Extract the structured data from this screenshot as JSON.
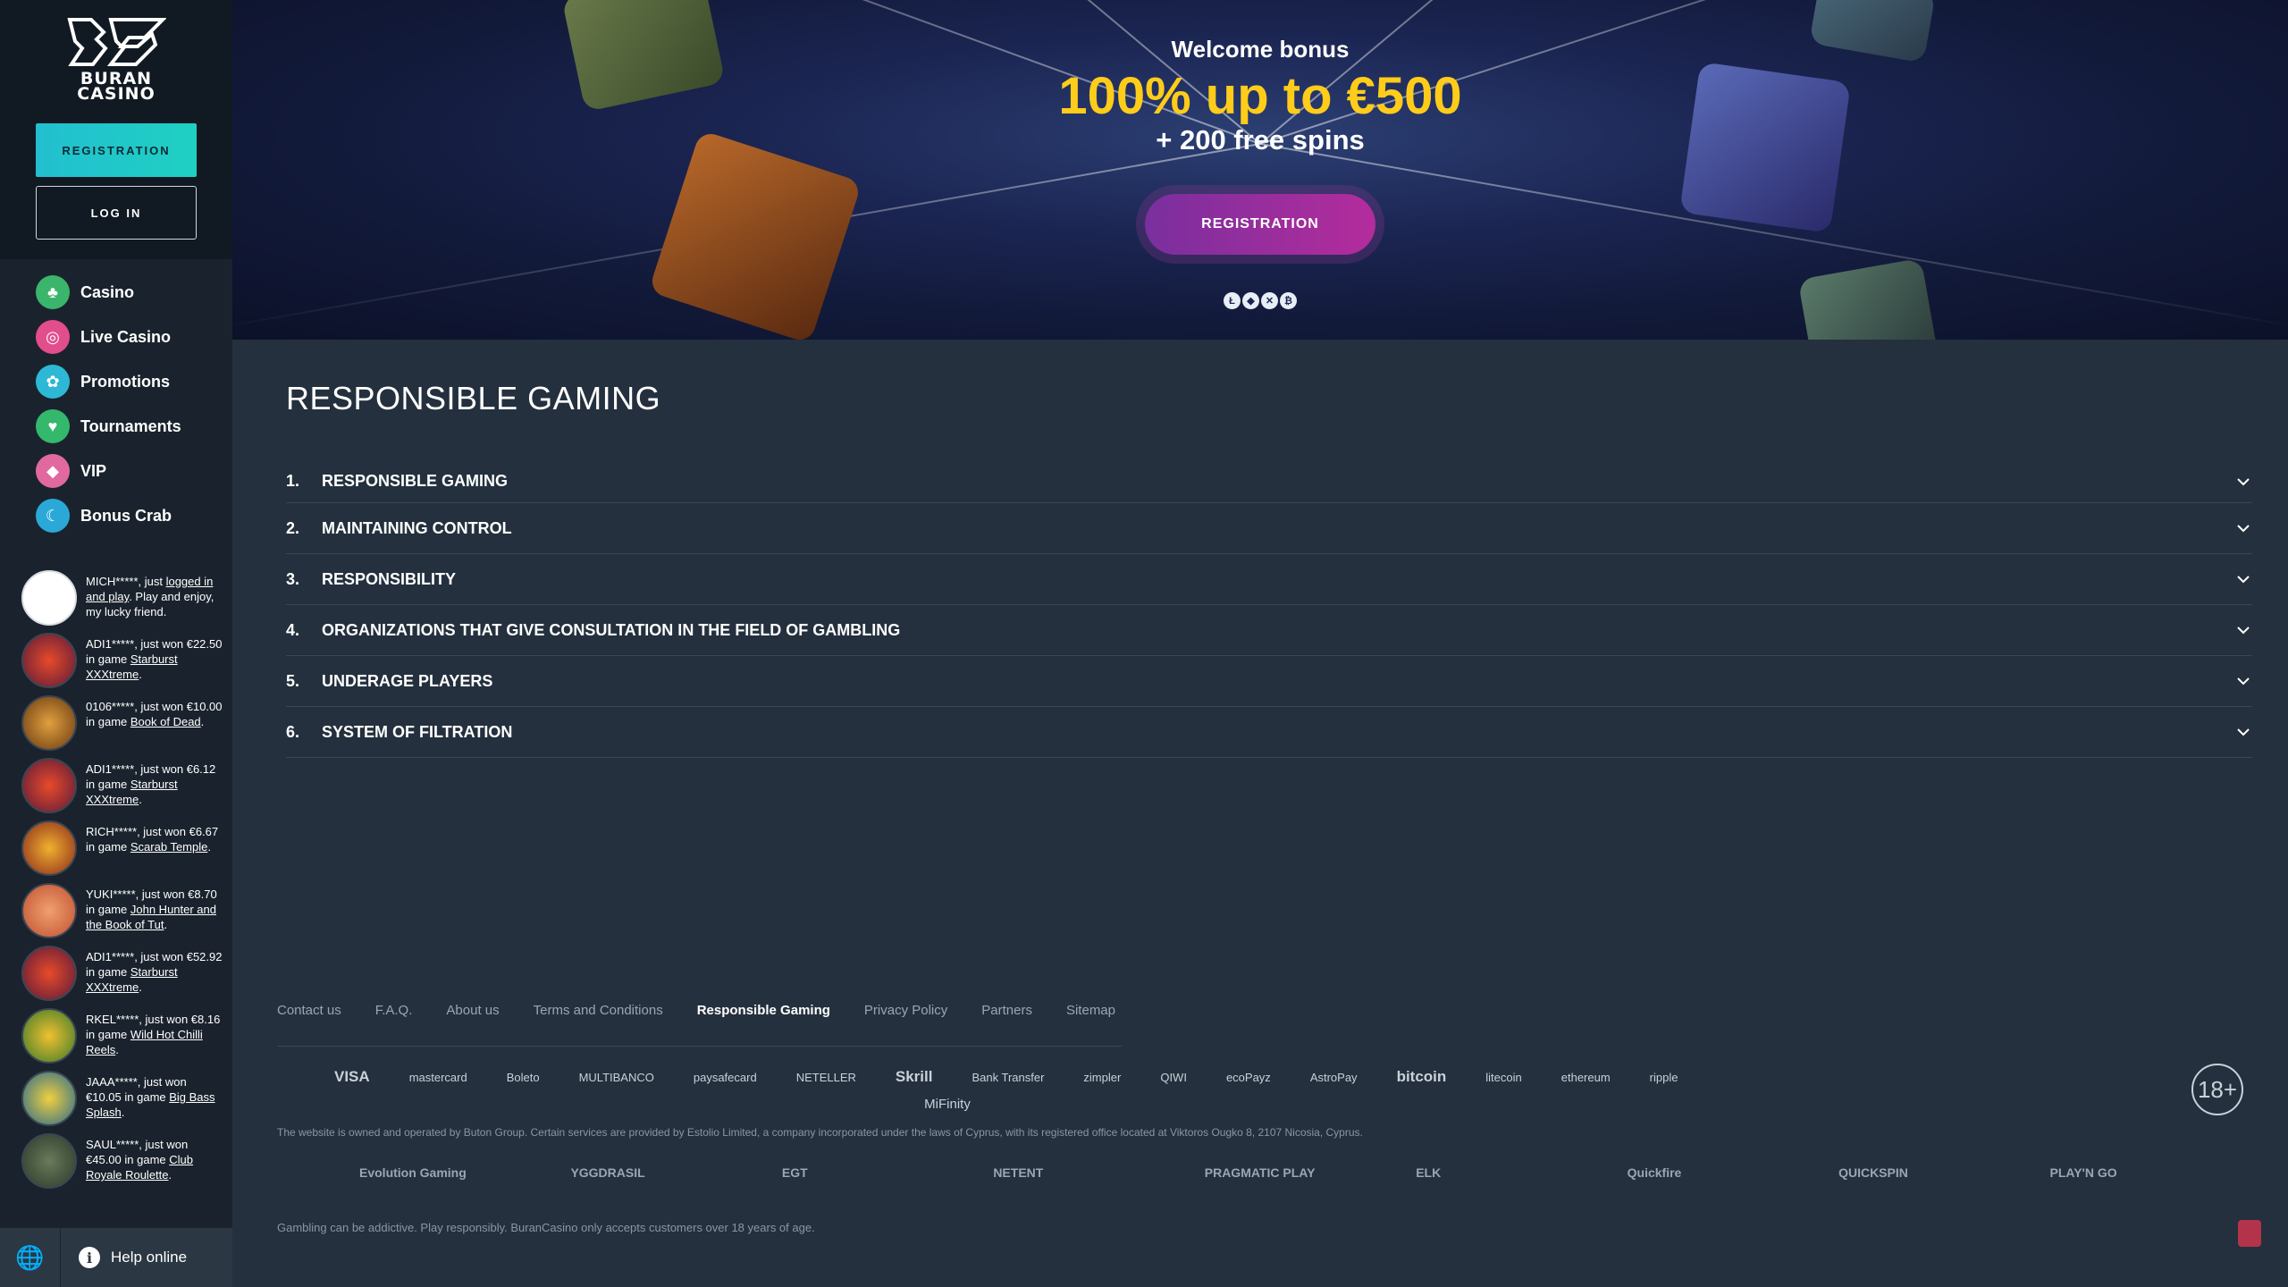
{
  "brand": {
    "logo_line1": "BURAN",
    "logo_line2": "CASINO"
  },
  "auth": {
    "register_label": "REGISTRATION",
    "login_label": "LOG IN"
  },
  "nav": [
    {
      "label": "Casino",
      "color": "#3bb56b",
      "icon": "casino-icon"
    },
    {
      "label": "Live Casino",
      "color": "#e24d8c",
      "icon": "live-casino-icon"
    },
    {
      "label": "Promotions",
      "color": "#2db9d6",
      "icon": "gift-icon"
    },
    {
      "label": "Tournaments",
      "color": "#33b86c",
      "icon": "trophy-icon"
    },
    {
      "label": "VIP",
      "color": "#e06aa0",
      "icon": "diamond-icon"
    },
    {
      "label": "Bonus Crab",
      "color": "#2aa9d8",
      "icon": "crab-icon"
    }
  ],
  "feed": [
    {
      "pre": "MICH*****, just ",
      "link": "logged in and play",
      "post": ". Play and enjoy, my lucky friend."
    },
    {
      "pre": "ADI1*****, just won €22.50 in game ",
      "link": "Starburst XXXtreme",
      "post": "."
    },
    {
      "pre": "0106*****, just won €10.00 in game ",
      "link": "Book of Dead",
      "post": "."
    },
    {
      "pre": "ADI1*****, just won €6.12 in game ",
      "link": "Starburst XXXtreme",
      "post": "."
    },
    {
      "pre": "RICH*****, just won €6.67 in game ",
      "link": "Scarab Temple",
      "post": "."
    },
    {
      "pre": "YUKI*****, just won €8.70 in game ",
      "link": "John Hunter and the Book of Tut",
      "post": "."
    },
    {
      "pre": "ADI1*****, just won €52.92 in game ",
      "link": "Starburst XXXtreme",
      "post": "."
    },
    {
      "pre": "RKEL*****, just won €8.16 in game ",
      "link": "Wild Hot Chilli Reels",
      "post": "."
    },
    {
      "pre": "JAAA*****, just won €10.05 in game ",
      "link": "Big Bass Splash",
      "post": "."
    },
    {
      "pre": "SAUL*****, just won €45.00 in game ",
      "link": "Club Royale Roulette",
      "post": "."
    }
  ],
  "help": {
    "label": "Help online"
  },
  "banner": {
    "welcome": "Welcome bonus",
    "amount": "100% up to €500",
    "spins": "+ 200 free spins",
    "button": "REGISTRATION"
  },
  "page": {
    "title": "RESPONSIBLE GAMING"
  },
  "sections": [
    {
      "num": "1.",
      "label": "RESPONSIBLE GAMING"
    },
    {
      "num": "2.",
      "label": "MAINTAINING CONTROL"
    },
    {
      "num": "3.",
      "label": "RESPONSIBILITY"
    },
    {
      "num": "4.",
      "label": "ORGANIZATIONS THAT GIVE CONSULTATION IN THE FIELD OF GAMBLING"
    },
    {
      "num": "5.",
      "label": "UNDERAGE PLAYERS"
    },
    {
      "num": "6.",
      "label": "SYSTEM OF FILTRATION"
    }
  ],
  "footer": {
    "links": [
      "Contact us",
      "F.A.Q.",
      "About us",
      "Terms and Conditions",
      "Responsible Gaming",
      "Privacy Policy",
      "Partners",
      "Sitemap"
    ],
    "active_link": "Responsible Gaming",
    "payments": [
      "VISA",
      "mastercard",
      "Boleto",
      "MULTIBANCO",
      "paysafecard",
      "NETELLER",
      "Skrill",
      "Bank Transfer",
      "zimpler",
      "QIWI",
      "ecoPayz",
      "AstroPay",
      "bitcoin",
      "litecoin",
      "ethereum",
      "ripple"
    ],
    "mifinity": "MiFinity",
    "age": "18+",
    "legal": "The website is owned and operated by Buton Group. Certain services are provided by Estolio Limited, a company incorporated under the laws of Cyprus, with its registered office located at Viktoros Ougko 8, 2107 Nicosia, Cyprus.",
    "providers": [
      "Evolution Gaming",
      "YGGDRASIL",
      "EGT",
      "NETENT",
      "PRAGMATIC PLAY",
      "ELK",
      "Quickfire",
      "QUICKSPIN",
      "PLAY'N GO"
    ],
    "gambling_note": "Gambling can be addictive. Play responsibly. BuranCasino only accepts customers over 18 years of age."
  }
}
